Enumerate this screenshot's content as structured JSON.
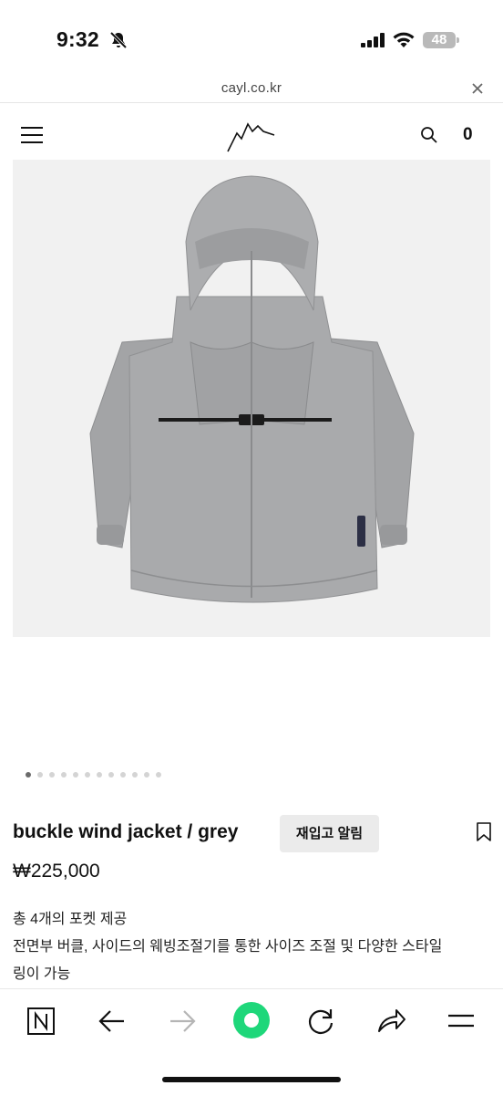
{
  "status_bar": {
    "time": "9:32",
    "battery": "48"
  },
  "browser": {
    "url": "cayl.co.kr"
  },
  "header": {
    "cart_count": "0"
  },
  "carousel": {
    "total": 12,
    "active": 0
  },
  "product": {
    "name": "buckle wind jacket / grey",
    "restock_label": "재입고 알림",
    "price": "₩225,000",
    "description": [
      "총 4개의 포켓 제공",
      "전면부 버클, 사이드의 웨빙조절기를 통한 사이즈 조절 및 다양한 스타일",
      "링이 가능"
    ]
  },
  "colors": {
    "accent_green": "#1ed77a",
    "jacket_grey": "#a9aaac"
  }
}
